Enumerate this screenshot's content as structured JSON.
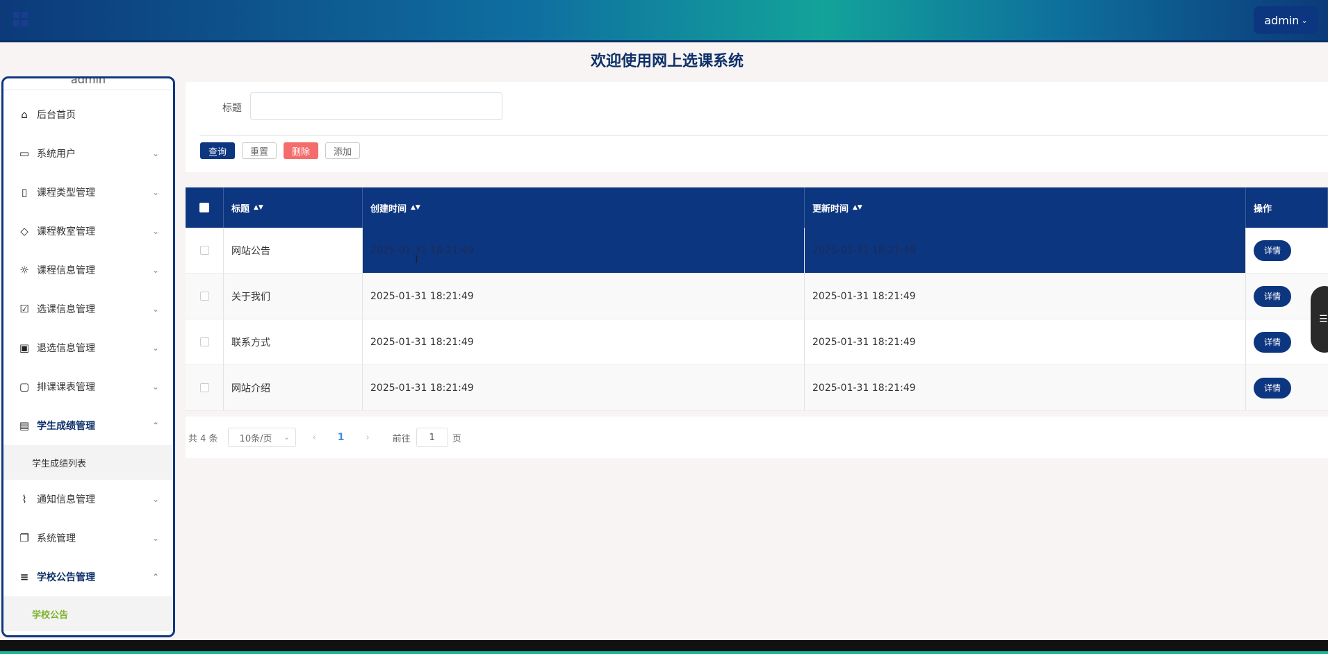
{
  "header": {
    "user_button": "admin",
    "chevron": "⌄"
  },
  "page_title": "欢迎使用网上选课系统",
  "sidebar": {
    "user_name": "admin",
    "items": [
      {
        "label": "后台首页",
        "icon": "home-icon",
        "glyph": "⌂",
        "expandable": false
      },
      {
        "label": "系统用户",
        "icon": "laptop-icon",
        "glyph": "▭",
        "expandable": true,
        "arrow": "⌄"
      },
      {
        "label": "课程类型管理",
        "icon": "bookmark-icon",
        "glyph": "▯",
        "expandable": true,
        "arrow": "⌄"
      },
      {
        "label": "课程教室管理",
        "icon": "tag-icon",
        "glyph": "◇",
        "expandable": true,
        "arrow": "⌄"
      },
      {
        "label": "课程信息管理",
        "icon": "sun-icon",
        "glyph": "☼",
        "expandable": true,
        "arrow": "⌄"
      },
      {
        "label": "选课信息管理",
        "icon": "inbox-icon",
        "glyph": "☑",
        "expandable": true,
        "arrow": "⌄"
      },
      {
        "label": "退选信息管理",
        "icon": "clipboard-icon",
        "glyph": "▣",
        "expandable": true,
        "arrow": "⌄"
      },
      {
        "label": "排课课表管理",
        "icon": "message-icon",
        "glyph": "▢",
        "expandable": true,
        "arrow": "⌄"
      },
      {
        "label": "学生成绩管理",
        "icon": "archive-icon",
        "glyph": "▤",
        "expandable": true,
        "open": true,
        "arrow": "⌃",
        "children": [
          {
            "label": "学生成绩列表"
          }
        ]
      },
      {
        "label": "通知信息管理",
        "icon": "paperclip-icon",
        "glyph": "⌇",
        "expandable": true,
        "arrow": "⌄"
      },
      {
        "label": "系统管理",
        "icon": "copy-icon",
        "glyph": "❐",
        "expandable": true,
        "arrow": "⌄"
      },
      {
        "label": "学校公告管理",
        "icon": "sliders-icon",
        "glyph": "≡",
        "expandable": true,
        "open": true,
        "arrow": "⌃",
        "children": [
          {
            "label": "学校公告",
            "active": true
          }
        ]
      }
    ]
  },
  "search": {
    "title_label": "标题",
    "title_value": "",
    "buttons": {
      "query": "查询",
      "reset": "重置",
      "delete": "删除",
      "add": "添加"
    }
  },
  "table": {
    "columns": [
      "标题",
      "创建时间",
      "更新时间",
      "操作"
    ],
    "sort_glyph": "▲▼",
    "rows": [
      {
        "title": "网站公告",
        "created": "2025-01-31 18:21:49",
        "updated": "2025-01-31 18:21:49",
        "action": "详情"
      },
      {
        "title": "关于我们",
        "created": "2025-01-31 18:21:49",
        "updated": "2025-01-31 18:21:49",
        "action": "详情"
      },
      {
        "title": "联系方式",
        "created": "2025-01-31 18:21:49",
        "updated": "2025-01-31 18:21:49",
        "action": "详情"
      },
      {
        "title": "网站介绍",
        "created": "2025-01-31 18:21:49",
        "updated": "2025-01-31 18:21:49",
        "action": "详情"
      }
    ]
  },
  "pagination": {
    "total": "共 4 条",
    "page_size": "10条/页",
    "current_page": "1",
    "goto_label": "前往",
    "goto_value": "1",
    "goto_unit": "页"
  },
  "float_tab": {
    "glyph": "☰"
  },
  "colors": {
    "primary": "#0d3680",
    "danger": "#f56c6c",
    "active_sub": "#7db32c",
    "accent_line": "#18b69a"
  }
}
